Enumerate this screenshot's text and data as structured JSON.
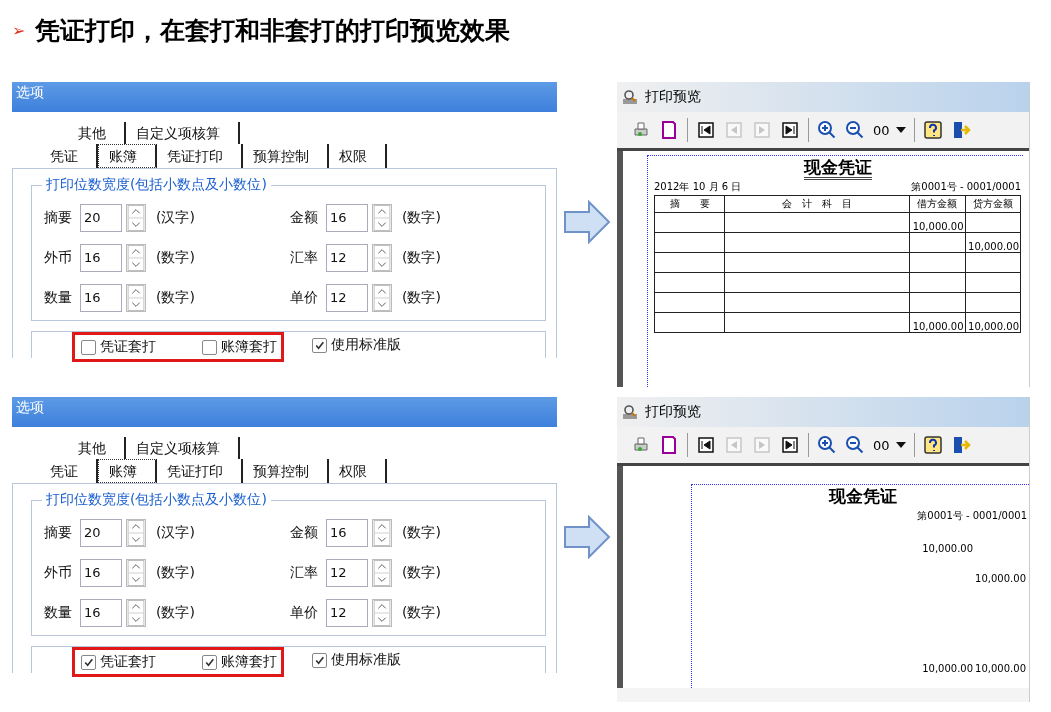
{
  "header": {
    "bullet": "➢",
    "text": "凭证打印，在套打和非套打的打印预览效果"
  },
  "examples": [
    {
      "dialog": {
        "title": "选项",
        "tab_rows": [
          [
            {
              "label": "其他",
              "selected": false
            },
            {
              "label": "自定义项核算",
              "selected": false
            }
          ],
          [
            {
              "label": "凭证",
              "selected": false
            },
            {
              "label": "账簿",
              "selected": true
            },
            {
              "label": "凭证打印",
              "selected": false
            },
            {
              "label": "预算控制",
              "selected": false
            },
            {
              "label": "权限",
              "selected": false
            }
          ]
        ],
        "group_title": "打印位数宽度(包括小数点及小数位)",
        "fields": [
          {
            "label": "摘要",
            "value": "20",
            "unit": "(汉字)"
          },
          {
            "label": "金额",
            "value": "16",
            "unit": "(数字)"
          },
          {
            "label": "外币",
            "value": "16",
            "unit": "(数字)"
          },
          {
            "label": "汇率",
            "value": "12",
            "unit": "(数字)"
          },
          {
            "label": "数量",
            "value": "16",
            "unit": "(数字)"
          },
          {
            "label": "单价",
            "value": "12",
            "unit": "(数字)"
          }
        ],
        "framed_checkboxes": [
          {
            "label": "凭证套打",
            "checked": false
          },
          {
            "label": "账簿套打",
            "checked": false
          }
        ],
        "checkboxes": [
          {
            "label": "使用标准版",
            "checked": true
          }
        ]
      },
      "preview": {
        "title": "打印预览",
        "zoom": "00",
        "toolbar": [
          {
            "kind": "print",
            "disabled": false
          },
          {
            "kind": "page",
            "disabled": false
          },
          {
            "kind": "sep"
          },
          {
            "kind": "first",
            "disabled": false
          },
          {
            "kind": "prev",
            "disabled": true
          },
          {
            "kind": "next",
            "disabled": true
          },
          {
            "kind": "last",
            "disabled": false
          },
          {
            "kind": "sep"
          },
          {
            "kind": "zoom-in",
            "disabled": false
          },
          {
            "kind": "zoom-out",
            "disabled": false
          },
          {
            "kind": "zoom"
          },
          {
            "kind": "sep"
          },
          {
            "kind": "help",
            "disabled": false
          },
          {
            "kind": "exit",
            "disabled": false
          }
        ],
        "document": {
          "kind": "ruled",
          "heading": "现金凭证",
          "date": "2012年 10 月 6 日",
          "number": "第0001号 - 0001/0001",
          "columns": [
            "摘　　要",
            "会　计　科　目",
            "借方金额",
            "贷方金额"
          ],
          "rows": [
            [
              "",
              "",
              "10,000.00",
              ""
            ],
            [
              "",
              "",
              "",
              "10,000.00"
            ],
            [
              "",
              "",
              "",
              ""
            ],
            [
              "",
              "",
              "",
              ""
            ],
            [
              "",
              "",
              "",
              ""
            ]
          ],
          "totals": [
            "10,000.00",
            "10,000.00"
          ]
        }
      }
    },
    {
      "dialog": {
        "title": "选项",
        "tab_rows": [
          [
            {
              "label": "其他",
              "selected": false
            },
            {
              "label": "自定义项核算",
              "selected": false
            }
          ],
          [
            {
              "label": "凭证",
              "selected": false
            },
            {
              "label": "账簿",
              "selected": true
            },
            {
              "label": "凭证打印",
              "selected": false
            },
            {
              "label": "预算控制",
              "selected": false
            },
            {
              "label": "权限",
              "selected": false
            }
          ]
        ],
        "group_title": "打印位数宽度(包括小数点及小数位)",
        "fields": [
          {
            "label": "摘要",
            "value": "20",
            "unit": "(汉字)"
          },
          {
            "label": "金额",
            "value": "16",
            "unit": "(数字)"
          },
          {
            "label": "外币",
            "value": "16",
            "unit": "(数字)"
          },
          {
            "label": "汇率",
            "value": "12",
            "unit": "(数字)"
          },
          {
            "label": "数量",
            "value": "16",
            "unit": "(数字)"
          },
          {
            "label": "单价",
            "value": "12",
            "unit": "(数字)"
          }
        ],
        "framed_checkboxes": [
          {
            "label": "凭证套打",
            "checked": true
          },
          {
            "label": "账簿套打",
            "checked": true
          }
        ],
        "checkboxes": [
          {
            "label": "使用标准版",
            "checked": true
          }
        ]
      },
      "preview": {
        "title": "打印预览",
        "zoom": "00",
        "toolbar": [
          {
            "kind": "print",
            "disabled": false
          },
          {
            "kind": "page",
            "disabled": false
          },
          {
            "kind": "sep"
          },
          {
            "kind": "first",
            "disabled": false
          },
          {
            "kind": "prev",
            "disabled": true
          },
          {
            "kind": "next",
            "disabled": true
          },
          {
            "kind": "last",
            "disabled": false
          },
          {
            "kind": "sep"
          },
          {
            "kind": "zoom-in",
            "disabled": false
          },
          {
            "kind": "zoom-out",
            "disabled": false
          },
          {
            "kind": "zoom"
          },
          {
            "kind": "sep"
          },
          {
            "kind": "help",
            "disabled": false
          },
          {
            "kind": "exit",
            "disabled": false
          }
        ],
        "document": {
          "kind": "plain",
          "heading": "现金凭证",
          "number": "第0001号 - 0001/0001",
          "rows": [
            [
              "",
              "",
              "10,000.00",
              ""
            ],
            [
              "",
              "",
              "",
              "10,000.00"
            ]
          ],
          "totals": [
            "10,000.00",
            "10,000.00"
          ]
        }
      }
    }
  ]
}
